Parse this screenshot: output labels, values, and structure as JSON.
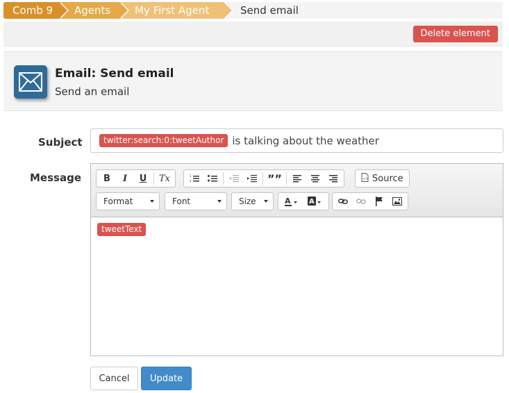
{
  "breadcrumb": {
    "items": [
      "Comb 9",
      "Agents",
      "My First Agent"
    ],
    "current": "Send email"
  },
  "toolbar": {
    "delete_label": "Delete element"
  },
  "header": {
    "icon": "envelope-icon",
    "title": "Email: Send email",
    "subtitle": "Send an email"
  },
  "form": {
    "subject_label": "Subject",
    "subject_tag": "twitter:search:0:tweetAuthor",
    "subject_text": "is talking about the weather",
    "message_label": "Message",
    "message_tag": "tweetText"
  },
  "editor_toolbar": {
    "source_label": "Source",
    "format_label": "Format",
    "font_label": "Font",
    "size_label": "Size",
    "bold": "B",
    "italic": "I",
    "underline": "U",
    "remove_format": "Tx",
    "blockquote": "””"
  },
  "actions": {
    "cancel_label": "Cancel",
    "update_label": "Update"
  },
  "colors": {
    "crumb1": "#d9902a",
    "crumb2": "#e6a949",
    "crumb3": "#efc076",
    "danger": "#d9534f",
    "primary": "#428bca",
    "icon_bg": "#2f6b98"
  }
}
